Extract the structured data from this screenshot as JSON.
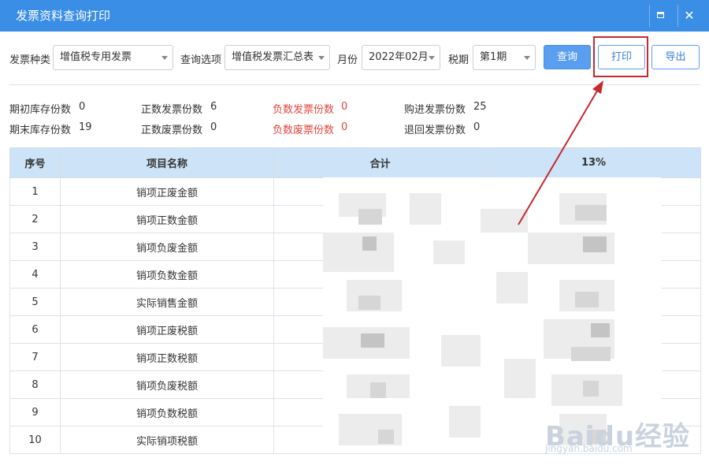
{
  "window": {
    "title": "发票资料查询打印",
    "maximize_icon": "maximize-icon",
    "close_icon": "close-icon",
    "close_glyph": "✕"
  },
  "filters": {
    "invoice_type_label": "发票种类",
    "invoice_type_value": "增值税专用发票",
    "query_option_label": "查询选项",
    "query_option_value": "增值税发票汇总表",
    "month_label": "月份",
    "month_value": "2022年02月",
    "period_label": "税期",
    "period_value": "第1期"
  },
  "buttons": {
    "query": "查询",
    "print": "打印",
    "export": "导出"
  },
  "stats": [
    {
      "label": "期初库存份数",
      "value": "0"
    },
    {
      "label": "正数发票份数",
      "value": "6"
    },
    {
      "label": "负数发票份数",
      "value": "0",
      "color": "#e0453a"
    },
    {
      "label": "购进发票份数",
      "value": "25"
    },
    {
      "label": "期末库存份数",
      "value": "19"
    },
    {
      "label": "正数废票份数",
      "value": "0"
    },
    {
      "label": "负数废票份数",
      "value": "0",
      "color": "#e0453a"
    },
    {
      "label": "退回发票份数",
      "value": "0"
    }
  ],
  "table": {
    "headers": [
      "序号",
      "项目名称",
      "合计",
      "13%"
    ],
    "rows": [
      {
        "no": "1",
        "name": "销项正废金额"
      },
      {
        "no": "2",
        "name": "销项正数金额"
      },
      {
        "no": "3",
        "name": "销项负废金额"
      },
      {
        "no": "4",
        "name": "销项负数金额"
      },
      {
        "no": "5",
        "name": "实际销售金额"
      },
      {
        "no": "6",
        "name": "销项正废税额"
      },
      {
        "no": "7",
        "name": "销项正数税额"
      },
      {
        "no": "8",
        "name": "销项负废税额"
      },
      {
        "no": "9",
        "name": "销项负数税额"
      },
      {
        "no": "10",
        "name": "实际销项税额"
      }
    ]
  },
  "watermark": {
    "brand": "Baidu经验",
    "url": "jingyan.baidu.com"
  },
  "colors": {
    "title_bar": "#3a8ee6",
    "accent": "#5a9ef0",
    "annotation_red": "#c9282d",
    "header_bg": "#cde3f7"
  }
}
